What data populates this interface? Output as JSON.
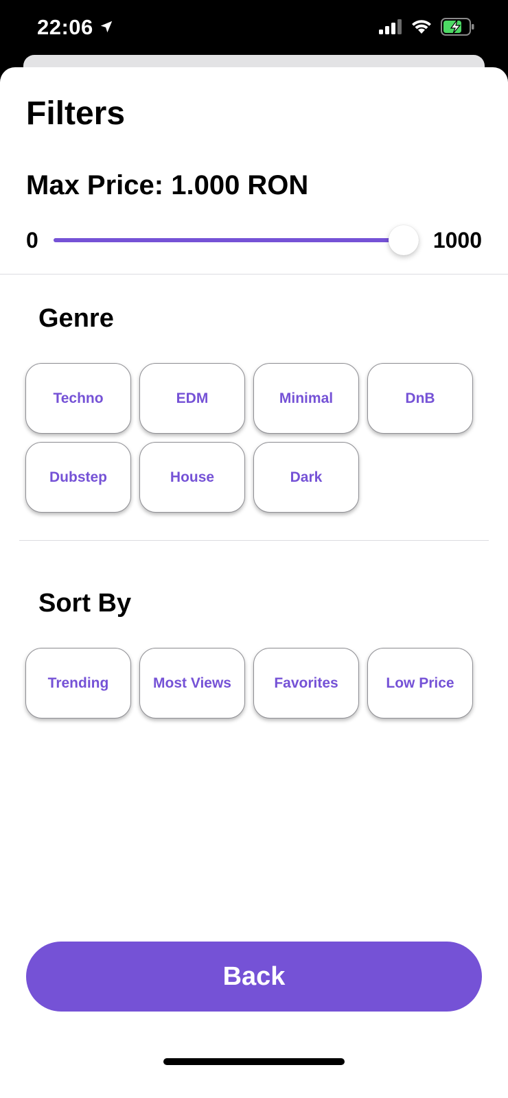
{
  "status_bar": {
    "time": "22:06",
    "icons": [
      "location-arrow-icon",
      "cellular-signal-icon",
      "wifi-icon",
      "battery-charging-icon"
    ]
  },
  "filters": {
    "title": "Filters",
    "max_price_label": "Max Price: 1.000 RON",
    "slider": {
      "min_label": "0",
      "max_label": "1000",
      "min": 0,
      "max": 1000,
      "value": 1000,
      "accent": "#7552d6"
    }
  },
  "genre": {
    "title": "Genre",
    "options": [
      "Techno",
      "EDM",
      "Minimal",
      "DnB",
      "Dubstep",
      "House",
      "Dark"
    ]
  },
  "sort": {
    "title": "Sort By",
    "options": [
      "Trending",
      "Most Views",
      "Favorites",
      "Low Price"
    ]
  },
  "back_button": {
    "label": "Back"
  },
  "colors": {
    "accent": "#7552d6",
    "background": "#ffffff",
    "status_bar": "#000000"
  }
}
